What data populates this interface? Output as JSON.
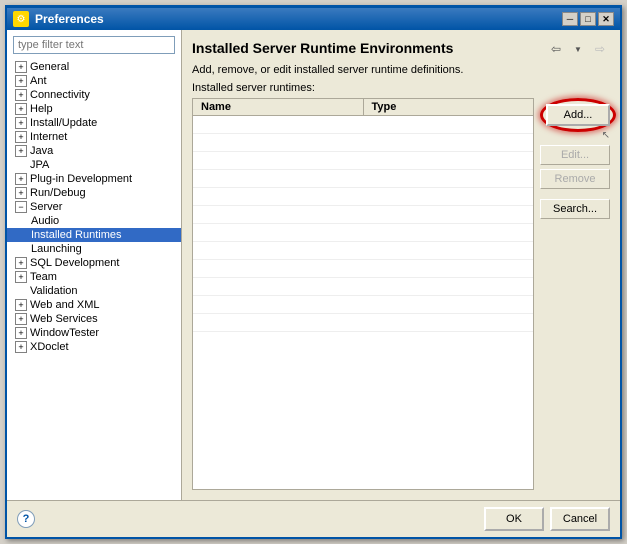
{
  "window": {
    "title": "Preferences",
    "icon": "⚙"
  },
  "title_buttons": {
    "minimize": "─",
    "maximize": "□",
    "close": "✕"
  },
  "filter": {
    "placeholder": "type filter text",
    "value": ""
  },
  "tree": {
    "items": [
      {
        "id": "general",
        "label": "General",
        "expanded": false,
        "indent": 0
      },
      {
        "id": "ant",
        "label": "Ant",
        "expanded": false,
        "indent": 0
      },
      {
        "id": "connectivity",
        "label": "Connectivity",
        "expanded": false,
        "indent": 0
      },
      {
        "id": "help",
        "label": "Help",
        "expanded": false,
        "indent": 0
      },
      {
        "id": "install-update",
        "label": "Install/Update",
        "expanded": false,
        "indent": 0
      },
      {
        "id": "internet",
        "label": "Internet",
        "expanded": false,
        "indent": 0
      },
      {
        "id": "java",
        "label": "Java",
        "expanded": false,
        "indent": 0
      },
      {
        "id": "jpa",
        "label": "JPA",
        "expanded": false,
        "indent": 0
      },
      {
        "id": "plugin-development",
        "label": "Plug-in Development",
        "expanded": false,
        "indent": 0
      },
      {
        "id": "run-debug",
        "label": "Run/Debug",
        "expanded": false,
        "indent": 0
      },
      {
        "id": "server",
        "label": "Server",
        "expanded": true,
        "indent": 0
      },
      {
        "id": "audio",
        "label": "Audio",
        "expanded": false,
        "indent": 1,
        "child": true
      },
      {
        "id": "installed-runtimes",
        "label": "Installed Runtimes",
        "expanded": false,
        "indent": 1,
        "child": true,
        "selected": true
      },
      {
        "id": "launching",
        "label": "Launching",
        "expanded": false,
        "indent": 1,
        "child": true
      },
      {
        "id": "sql-development",
        "label": "SQL Development",
        "expanded": false,
        "indent": 0
      },
      {
        "id": "team",
        "label": "Team",
        "expanded": false,
        "indent": 0
      },
      {
        "id": "validation",
        "label": "Validation",
        "expanded": false,
        "indent": 0
      },
      {
        "id": "web-and-xml",
        "label": "Web and XML",
        "expanded": false,
        "indent": 0
      },
      {
        "id": "web-services",
        "label": "Web Services",
        "expanded": false,
        "indent": 0
      },
      {
        "id": "windowtester",
        "label": "WindowTester",
        "expanded": false,
        "indent": 0
      },
      {
        "id": "xdoclet",
        "label": "XDoclet",
        "expanded": false,
        "indent": 0
      }
    ]
  },
  "main": {
    "title": "Installed Server Runtime Environments",
    "description": "Add, remove, or edit installed server runtime definitions.",
    "table_label": "Installed server runtimes:",
    "columns": [
      {
        "id": "name",
        "label": "Name"
      },
      {
        "id": "type",
        "label": "Type"
      }
    ],
    "rows": [],
    "buttons": {
      "add": "Add...",
      "edit": "Edit...",
      "remove": "Remove",
      "search": "Search..."
    }
  },
  "footer": {
    "ok": "OK",
    "cancel": "Cancel",
    "help_icon": "?"
  }
}
